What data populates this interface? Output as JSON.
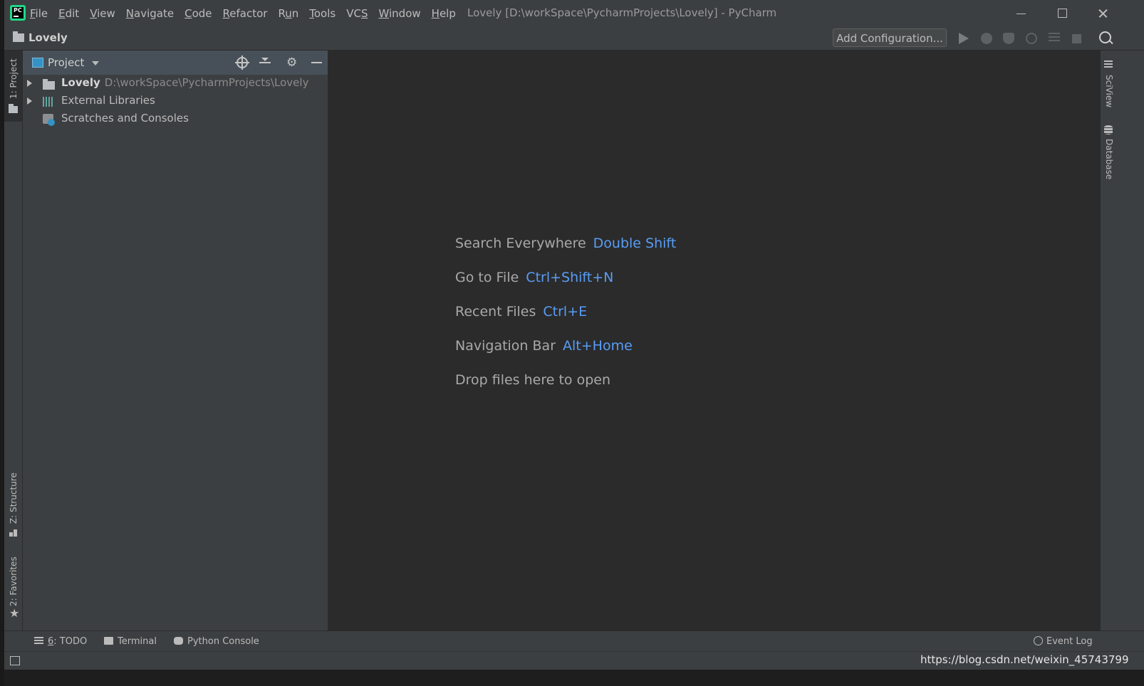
{
  "window": {
    "title": "Lovely [D:\\workSpace\\PycharmProjects\\Lovely] - PyCharm",
    "logo_text": "PC"
  },
  "menu": [
    {
      "pre": "",
      "mnemonic": "F",
      "post": "ile"
    },
    {
      "pre": "",
      "mnemonic": "E",
      "post": "dit"
    },
    {
      "pre": "",
      "mnemonic": "V",
      "post": "iew"
    },
    {
      "pre": "",
      "mnemonic": "N",
      "post": "avigate"
    },
    {
      "pre": "",
      "mnemonic": "C",
      "post": "ode"
    },
    {
      "pre": "",
      "mnemonic": "R",
      "post": "efactor"
    },
    {
      "pre": "R",
      "mnemonic": "u",
      "post": "n"
    },
    {
      "pre": "",
      "mnemonic": "T",
      "post": "ools"
    },
    {
      "pre": "VC",
      "mnemonic": "S",
      "post": ""
    },
    {
      "pre": "",
      "mnemonic": "W",
      "post": "indow"
    },
    {
      "pre": "",
      "mnemonic": "H",
      "post": "elp"
    }
  ],
  "navbar": {
    "project": "Lovely",
    "add_configuration": "Add Configuration..."
  },
  "left_stripe": {
    "project": "1: Project",
    "structure": "Z: Structure",
    "favorites": "2: Favorites"
  },
  "right_stripe": {
    "sciview": "SciView",
    "database": "Database"
  },
  "project_panel": {
    "title": "Project",
    "tree": {
      "root_name": "Lovely",
      "root_path": "D:\\workSpace\\PycharmProjects\\Lovely",
      "external_libraries": "External Libraries",
      "scratches": "Scratches and Consoles"
    }
  },
  "editor_hints": {
    "search_label": "Search Everywhere",
    "search_key": "Double Shift",
    "goto_label": "Go to File",
    "goto_key": "Ctrl+Shift+N",
    "recent_label": "Recent Files",
    "recent_key": "Ctrl+E",
    "navbar_label": "Navigation Bar",
    "navbar_key": "Alt+Home",
    "drop_label": "Drop files here to open"
  },
  "bottom_toolbar": {
    "todo_mnemonic": "6",
    "todo_rest": ": TODO",
    "terminal": "Terminal",
    "python_console": "Python Console",
    "event_log": "Event Log"
  },
  "status": {
    "watermark": "https://blog.csdn.net/weixin_45743799"
  },
  "colors": {
    "accent_link": "#589df6",
    "editor_bg": "#2b2b2b",
    "panel_bg": "#3c3f41",
    "panel_header": "#475058"
  }
}
